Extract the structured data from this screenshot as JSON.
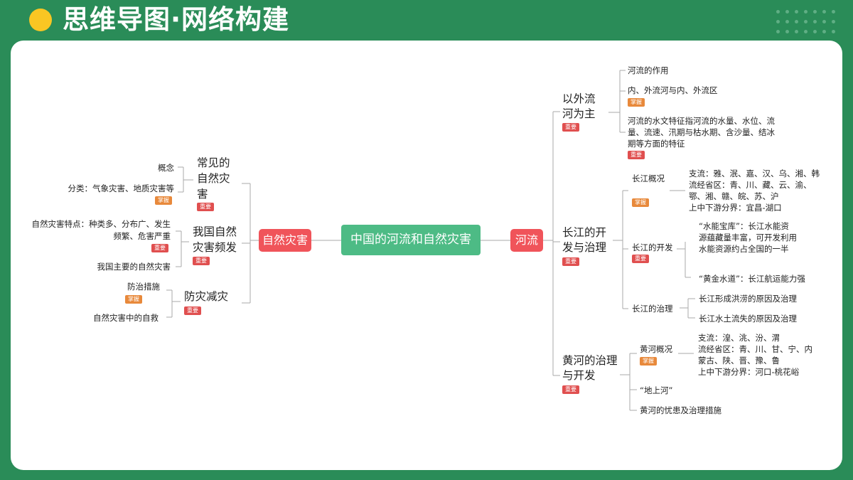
{
  "header": {
    "title": "思维导图·网络构建"
  },
  "tags": {
    "important": "重要",
    "master": "掌握"
  },
  "center": "中国的河流和自然灾害",
  "left_branch": {
    "label": "自然灾害",
    "groups": [
      {
        "label": "常见的自然灾害",
        "lines": [
          "常见的",
          "自然灾",
          "害"
        ],
        "items": [
          "概念",
          "分类：气象灾害、地质灾害等"
        ]
      },
      {
        "label": "我国自然灾害频发",
        "lines": [
          "我国自然",
          "灾害频发"
        ],
        "items": [
          "自然灾害特点：种类多、分布广、发生",
          "频繁、危害严重",
          "我国主要的自然灾害"
        ]
      },
      {
        "label": "防灾减灾",
        "lines": [
          "防灾减灾"
        ],
        "items": [
          "防治措施",
          "自然灾害中的自救"
        ]
      }
    ]
  },
  "right_branch": {
    "label": "河流",
    "groups": [
      {
        "lines": [
          "以外流",
          "河为主"
        ],
        "items": [
          "河流的作用",
          "内、外流河与内、外流区",
          "河流的水文特征指河流的水量、水位、流",
          "量、流速、汛期与枯水期、含沙量、结冰",
          "期等方面的特征"
        ]
      },
      {
        "lines": [
          "长江的开",
          "发与治理"
        ],
        "subs": [
          {
            "label": "长江概况",
            "items": [
              "支流：雅、泯、嘉、汉、乌、湘、韩",
              "流经省区：青、川、藏、云、渝、",
              "鄂、湘、赣、皖、苏、沪",
              "上中下游分界：宜昌-湖口"
            ]
          },
          {
            "label": "长江的开发",
            "items": [
              "“水能宝库”：长江水能资",
              "源蕴藏量丰富，可开发利用",
              "水能资源约占全国的一半",
              "“黄金水道”：长江航运能力强"
            ]
          },
          {
            "label": "长江的治理",
            "items": [
              "长江形成洪涝的原因及治理",
              "长江水土流失的原因及治理"
            ]
          }
        ]
      },
      {
        "lines": [
          "黄河的治理",
          "与开发"
        ],
        "subs": [
          {
            "label": "黄河概况",
            "items": [
              "支流：湟、洮、汾、渭",
              "流经省区：青、川、甘、宁、内",
              "蒙古、陕、晋、豫、鲁",
              "上中下游分界：河口-桃花峪"
            ]
          },
          {
            "label": "“地上河”"
          },
          {
            "label": "黄河的忧患及治理措施"
          }
        ]
      }
    ]
  }
}
